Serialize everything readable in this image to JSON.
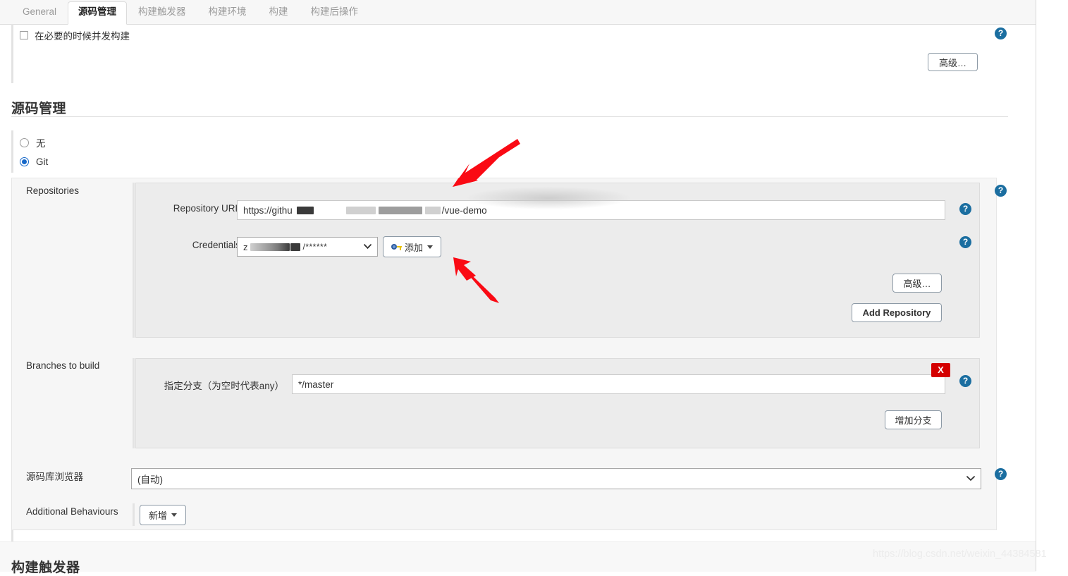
{
  "tabs": [
    {
      "label": "General",
      "active": false
    },
    {
      "label": "源码管理",
      "active": true
    },
    {
      "label": "构建触发器",
      "active": false
    },
    {
      "label": "构建环境",
      "active": false
    },
    {
      "label": "构建",
      "active": false
    },
    {
      "label": "构建后操作",
      "active": false
    }
  ],
  "top": {
    "concurrent_build_label": "在必要的时候并发构建",
    "advanced_label": "高级…"
  },
  "scm": {
    "heading": "源码管理",
    "options": [
      {
        "label": "无",
        "selected": false
      },
      {
        "label": "Git",
        "selected": true
      }
    ]
  },
  "repositories": {
    "label": "Repositories",
    "url_label": "Repository URL",
    "url_value_prefix": "https://githu",
    "url_value_suffix": "/vue-demo",
    "credentials_label": "Credentials",
    "credentials_value_prefix": "z",
    "credentials_value_suffix": "/******",
    "add_credentials_label": "添加",
    "advanced_label": "高级…",
    "add_repository_label": "Add Repository"
  },
  "branches": {
    "label": "Branches to build",
    "specifier_label": "指定分支（为空时代表any）",
    "specifier_value": "*/master",
    "delete_label": "X",
    "add_branch_label": "增加分支"
  },
  "browser": {
    "label": "源码库浏览器",
    "value": "(自动)"
  },
  "behaviours": {
    "label": "Additional Behaviours",
    "add_label": "新增"
  },
  "next_section": {
    "heading": "构建触发器"
  },
  "help_icon": "?",
  "watermark": "https://blog.csdn.net/weixin_44384581",
  "colors": {
    "accent_help": "#1b6ea0",
    "radio_selected": "#1567c8",
    "delete_button": "#d40000",
    "arrow_annotation": "#fa0a14",
    "panel_bg": "#ececec"
  }
}
